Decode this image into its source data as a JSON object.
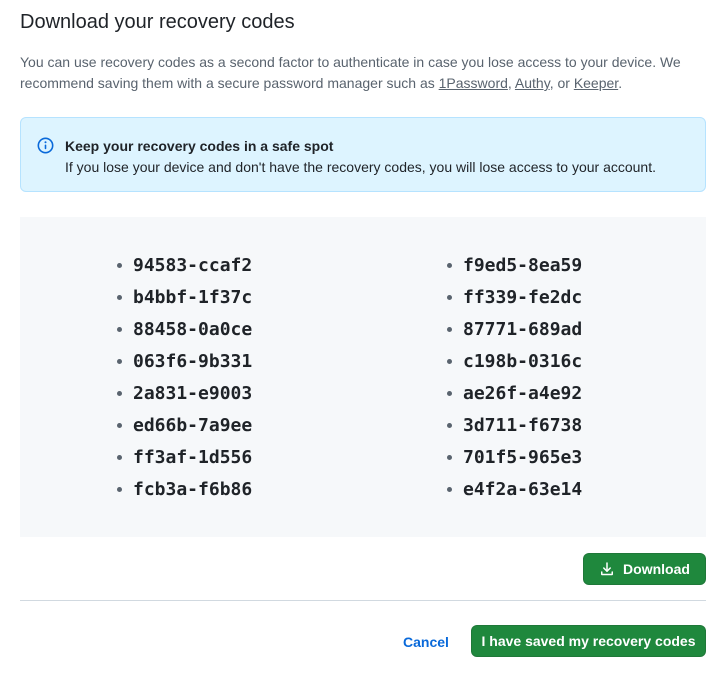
{
  "dialog": {
    "title": "Download your recovery codes",
    "description": {
      "text_before": "You can use recovery codes as a second factor to authenticate in case you lose access to your device. We recommend saving them with a secure password manager such as ",
      "link1": "1Password",
      "sep1": ", ",
      "link2": "Authy",
      "sep2": ", or ",
      "link3": "Keeper",
      "text_after": "."
    },
    "flash": {
      "icon": "info-icon",
      "title": "Keep your recovery codes in a safe spot",
      "body": "If you lose your device and don't have the recovery codes, you will lose access to your account."
    },
    "codes": {
      "left": [
        "94583-ccaf2",
        "b4bbf-1f37c",
        "88458-0a0ce",
        "063f6-9b331",
        "2a831-e9003",
        "ed66b-7a9ee",
        "ff3af-1d556",
        "fcb3a-f6b86"
      ],
      "right": [
        "f9ed5-8ea59",
        "ff339-fe2dc",
        "87771-689ad",
        "c198b-0316c",
        "ae26f-a4e92",
        "3d711-f6738",
        "701f5-965e3",
        "e4f2a-63e14"
      ]
    },
    "download_button": {
      "icon": "download-icon",
      "label": "Download"
    },
    "cancel_label": "Cancel",
    "confirm_label": "I have saved my recovery codes"
  },
  "colors": {
    "primary_green": "#1f883d",
    "link_blue": "#0969da",
    "flash_bg": "#ddf4ff",
    "codes_bg": "#f6f8fa"
  }
}
